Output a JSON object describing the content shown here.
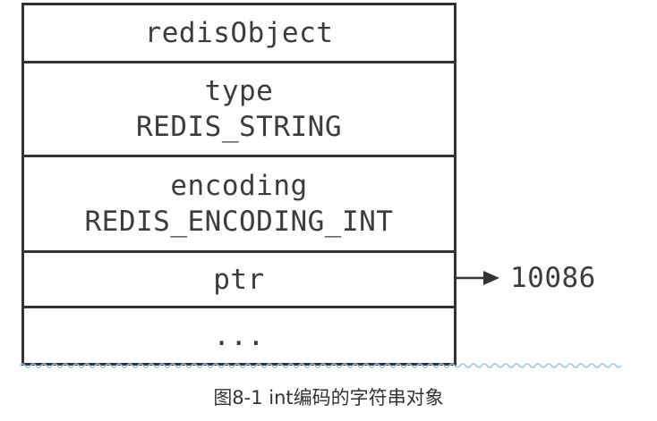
{
  "diagram": {
    "struct_name": "redisObject",
    "fields": [
      {
        "name": "type",
        "value": "REDIS_STRING"
      },
      {
        "name": "encoding",
        "value": "REDIS_ENCODING_INT"
      },
      {
        "name": "ptr",
        "value": ""
      },
      {
        "name": "...",
        "value": ""
      }
    ],
    "ptr_target": "10086"
  },
  "caption": "图8-1 int编码的字符串对象",
  "colors": {
    "border": "#333333",
    "text": "#3c3c3c",
    "wavy_line": "#9ec6ea"
  }
}
